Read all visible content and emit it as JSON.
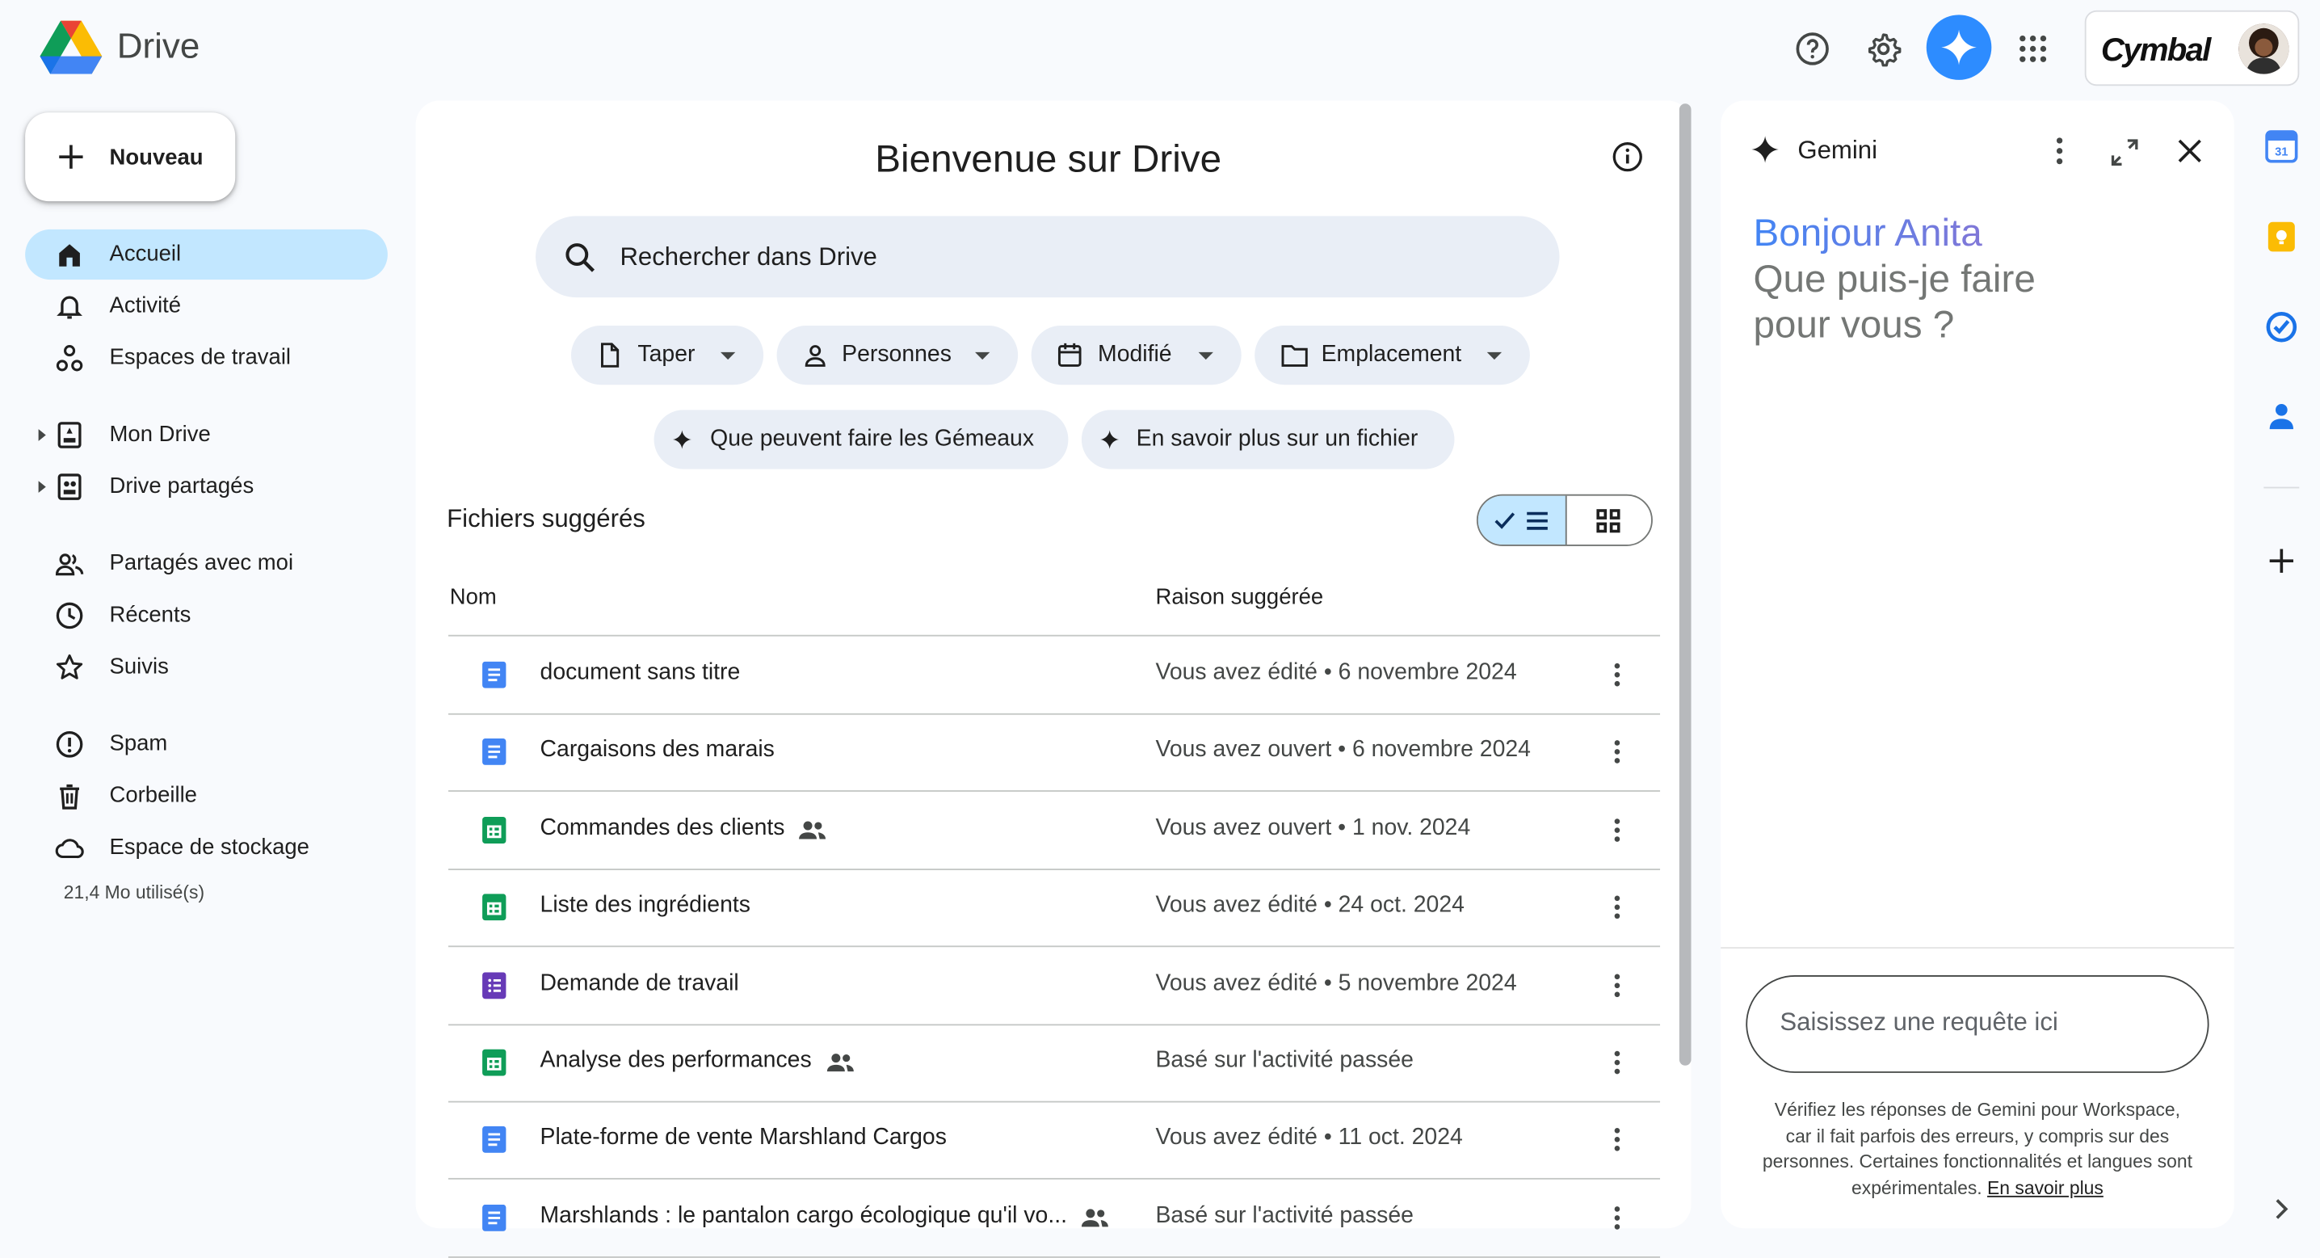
{
  "app": {
    "name": "Drive",
    "brand": "Cymbal"
  },
  "header": {
    "help_label": "Aide",
    "settings_label": "Paramètres",
    "gemini_label": "Gemini",
    "apps_label": "Applications Google"
  },
  "sidebar": {
    "new_label": "Nouveau",
    "items": [
      {
        "label": "Accueil",
        "icon": "home-icon"
      },
      {
        "label": "Activité",
        "icon": "bell-icon"
      },
      {
        "label": "Espaces de travail",
        "icon": "workspaces-icon"
      },
      {
        "label": "Mon Drive",
        "icon": "my-drive-icon"
      },
      {
        "label": "Drive partagés",
        "icon": "shared-drives-icon"
      },
      {
        "label": "Partagés avec moi",
        "icon": "people-icon"
      },
      {
        "label": "Récents",
        "icon": "clock-icon"
      },
      {
        "label": "Suivis",
        "icon": "star-icon"
      },
      {
        "label": "Spam",
        "icon": "spam-icon"
      },
      {
        "label": "Corbeille",
        "icon": "trash-icon"
      },
      {
        "label": "Espace de stockage",
        "icon": "cloud-icon"
      }
    ],
    "storage_used": "21,4 Mo utilisé(s)"
  },
  "main": {
    "title": "Bienvenue sur Drive",
    "search_placeholder": "Rechercher dans Drive",
    "filters": [
      "Taper",
      "Personnes",
      "Modifié",
      "Emplacement"
    ],
    "suggestions": [
      "Que peuvent faire les Gémeaux",
      "En savoir plus sur un fichier"
    ],
    "section_title": "Fichiers suggérés",
    "columns": {
      "name": "Nom",
      "reason": "Raison suggérée"
    },
    "files": [
      {
        "name": "document sans titre",
        "reason": "Vous avez édité • 6 novembre 2024",
        "type": "doc",
        "shared": false
      },
      {
        "name": "Cargaisons des marais",
        "reason": "Vous avez ouvert • 6 novembre 2024",
        "type": "doc",
        "shared": false
      },
      {
        "name": "Commandes des clients",
        "reason": "Vous avez ouvert • 1 nov. 2024",
        "type": "sheet",
        "shared": true
      },
      {
        "name": "Liste des ingrédients",
        "reason": "Vous avez édité • 24 oct. 2024",
        "type": "sheet",
        "shared": false
      },
      {
        "name": "Demande de travail",
        "reason": "Vous avez édité • 5 novembre 2024",
        "type": "form",
        "shared": false
      },
      {
        "name": "Analyse des performances",
        "reason": "Basé sur l'activité passée",
        "type": "sheet",
        "shared": true
      },
      {
        "name": "Plate-forme de vente Marshland Cargos",
        "reason": "Vous avez édité • 11 oct. 2024",
        "type": "doc",
        "shared": false
      },
      {
        "name": "Marshlands : le pantalon cargo écologique qu'il vo...",
        "reason": "Basé sur l'activité passée",
        "type": "doc",
        "shared": true
      }
    ]
  },
  "gemini": {
    "title": "Gemini",
    "greeting": "Bonjour Anita",
    "question": "Que puis-je faire pour vous ?",
    "input_placeholder": "Saisissez une requête ici",
    "disclaimer": "Vérifiez les réponses de Gemini pour Workspace, car il fait parfois des erreurs, y compris sur des personnes. Certaines fonctionnalités et langues sont expérimentales.",
    "learn_more": "En savoir plus"
  },
  "colors": {
    "accent": "#0b57d0",
    "active_nav": "#c2e7ff",
    "chip_bg": "#e9eef6",
    "doc": "#4285f4",
    "sheet": "#0f9d58",
    "form": "#673ab7"
  }
}
